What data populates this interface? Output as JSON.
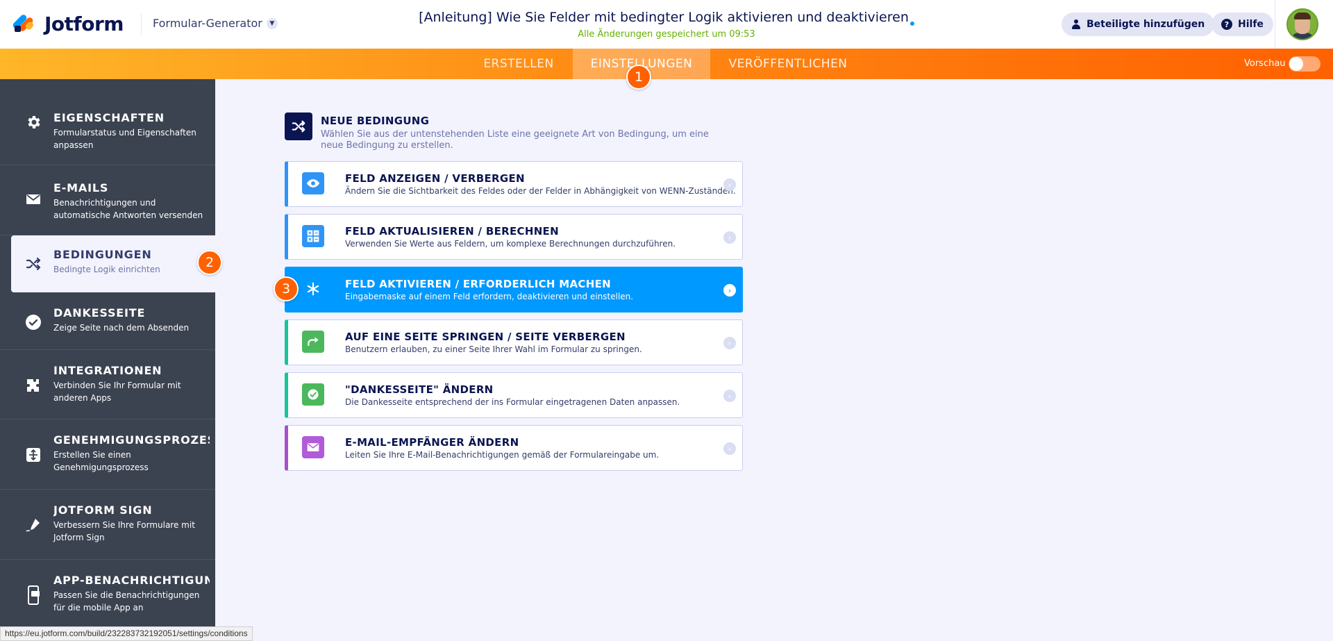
{
  "header": {
    "logo_text": "Jotform",
    "builder_switch": "Formular-Generator",
    "form_title": "[Anleitung] Wie Sie Felder mit bedingter Logik aktivieren und deaktivieren",
    "save_status": "Alle Änderungen gespeichert um 09:53",
    "collab_button": "Beteiligte hinzufügen",
    "help_button": "Hilfe"
  },
  "nav": {
    "tabs": [
      {
        "label": "ERSTELLEN"
      },
      {
        "label": "EINSTELLUNGEN"
      },
      {
        "label": "VERÖFFENTLICHEN"
      }
    ],
    "active_tab": "EINSTELLUNGEN",
    "preview_label": "Vorschau",
    "preview_on": false
  },
  "badges": {
    "b1": "1",
    "b2": "2",
    "b3": "3"
  },
  "sidebar": {
    "items": [
      {
        "title": "EIGENSCHAFTEN",
        "desc": "Formularstatus und Eigenschaften anpassen",
        "icon": "gear-icon"
      },
      {
        "title": "E-MAILS",
        "desc": "Benachrichtigungen und automatische Antworten versenden",
        "icon": "envelope-icon"
      },
      {
        "title": "BEDINGUNGEN",
        "desc": "Bedingte Logik einrichten",
        "icon": "shuffle-icon",
        "active": true
      },
      {
        "title": "DANKESSEITE",
        "desc": "Zeige Seite nach dem Absenden",
        "icon": "check-circle-icon"
      },
      {
        "title": "INTEGRATIONEN",
        "desc": "Verbinden Sie Ihr Formular mit anderen Apps",
        "icon": "puzzle-icon"
      },
      {
        "title": "GENEHMIGUNGSPROZES...",
        "desc": "Erstellen Sie einen Genehmigungsprozess",
        "icon": "workflow-icon"
      },
      {
        "title": "JOTFORM SIGN",
        "desc": "Verbessern Sie Ihre Formulare mit Jotform Sign",
        "icon": "pen-sign-icon"
      },
      {
        "title": "APP-BENACHRICHTIGUNG",
        "desc": "Passen Sie die Benachrichtigungen für die mobile App an",
        "icon": "mobile-icon"
      }
    ]
  },
  "main": {
    "new_condition_title": "NEUE BEDINGUNG",
    "new_condition_desc": "Wählen Sie aus der untenstehenden Liste eine geeignete Art von Bedingung, um eine neue Bedingung zu erstellen.",
    "conditions": [
      {
        "title": "FELD ANZEIGEN / VERBERGEN",
        "desc": "Ändern Sie die Sichtbarkeit des Feldes oder der Felder in Abhängigkeit von WENN-Zuständen.",
        "icon": "eye-icon",
        "color": "#2f94f5"
      },
      {
        "title": "FELD AKTUALISIEREN / BERECHNEN",
        "desc": "Verwenden Sie Werte aus Feldern, um komplexe Berechnungen durchzuführen.",
        "icon": "calculator-icon",
        "color": "#2f94f5"
      },
      {
        "title": "FELD AKTIVIEREN / ERFORDERLICH MACHEN",
        "desc": "Eingabemaske auf einem Feld erfordern, deaktivieren und einstellen.",
        "icon": "asterisk-icon",
        "color": "#0099ff",
        "selected": true
      },
      {
        "title": "AUF EINE SEITE SPRINGEN / SEITE VERBERGEN",
        "desc": "Benutzern erlauben, zu einer Seite Ihrer Wahl im Formular zu springen.",
        "icon": "skip-arrow-icon",
        "color": "#19c39a"
      },
      {
        "title": "\"DANKESSEITE\" ÄNDERN",
        "desc": "Die Dankesseite entsprechend der ins Formular eingetragenen Daten anpassen.",
        "icon": "check-icon",
        "color": "#19c39a"
      },
      {
        "title": "E-MAIL-EMPFÄNGER ÄNDERN",
        "desc": "Leiten Sie Ihre E-Mail-Benachrichtigungen gemäß der Formulareingabe um.",
        "icon": "mail-icon",
        "color": "#a552c9"
      }
    ]
  },
  "status_bar": {
    "url": "https://eu.jotform.com/build/232283732192051/settings/conditions"
  },
  "colors": {
    "accent_orange": "#ff6100",
    "nav_gradient_start": "#ffb629",
    "sidebar_bg": "#3b4250",
    "selected_blue": "#0099ff"
  }
}
